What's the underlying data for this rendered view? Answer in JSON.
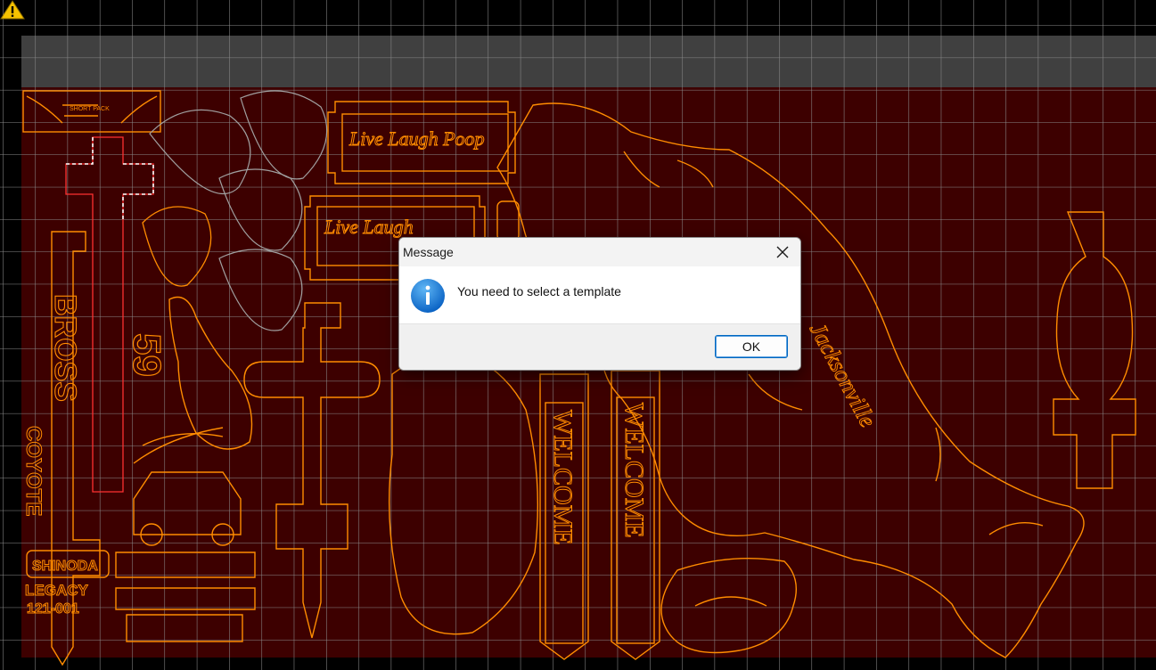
{
  "dialog": {
    "title": "Message",
    "message": "You need to select a template",
    "ok_label": "OK",
    "icon": "info-icon"
  },
  "canvas": {
    "designs": {
      "sign_top_small": "SHORT PACK",
      "sign_large_1": "Live Laugh Poop",
      "sign_large_2": "Live Laugh",
      "vertical_1": "BROSS",
      "vertical_2": "COYOTE",
      "plate_1": "SHINODA",
      "plate_2": "LEGACY",
      "plate_3": "121-001",
      "welcome_1": "WELCOME",
      "welcome_2": "WELCOME",
      "script_text": "Jacksonville",
      "number_text": "59"
    },
    "colors": {
      "background": "#3a0000",
      "bed_header": "#404040",
      "outline": "#ff8c00",
      "grid": "#8a8a8a",
      "selection": "#ff3030"
    }
  },
  "icons": {
    "warning": "warning-icon"
  }
}
